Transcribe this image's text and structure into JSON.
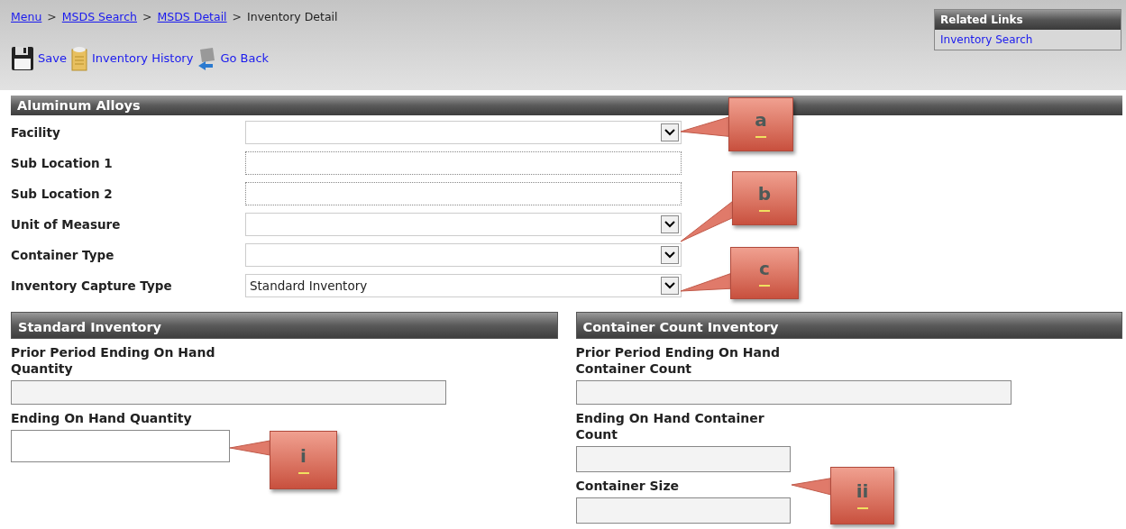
{
  "breadcrumb": [
    {
      "label": "Menu",
      "link": true
    },
    {
      "label": "MSDS Search",
      "link": true
    },
    {
      "label": "MSDS Detail",
      "link": true
    },
    {
      "label": "Inventory Detail",
      "link": false
    }
  ],
  "breadcrumb_separator": ">",
  "toolbar": [
    {
      "label": "Save",
      "kind": "save"
    },
    {
      "label": "Inventory History",
      "kind": "history"
    },
    {
      "label": "Go Back",
      "kind": "back"
    }
  ],
  "related_links": {
    "title": "Related Links",
    "items": [
      "Inventory Search"
    ]
  },
  "section": {
    "title": "Aluminum Alloys",
    "fields": [
      {
        "label": "Facility",
        "kind": "select"
      },
      {
        "label": "Sub Location 1",
        "kind": "text"
      },
      {
        "label": "Sub Location 2",
        "kind": "text"
      },
      {
        "label": "Unit of Measure",
        "kind": "select"
      },
      {
        "label": "Container Type",
        "kind": "select"
      },
      {
        "label": "Inventory Capture Type",
        "kind": "select",
        "value": "Standard Inventory"
      }
    ]
  },
  "panels": [
    {
      "title": "Standard Inventory",
      "fields": [
        {
          "label": "Prior Period Ending On Hand Quantity",
          "disabled": true,
          "kind": "wide"
        },
        {
          "label": "Ending On Hand Quantity",
          "disabled": false,
          "kind": "short"
        }
      ]
    },
    {
      "title": "Container Count Inventory",
      "fields": [
        {
          "label": "Prior Period Ending On Hand Container Count",
          "disabled": true,
          "kind": "wide"
        },
        {
          "label": "Ending On Hand Container Count",
          "disabled": true,
          "kind": "short"
        },
        {
          "label": "Container Size",
          "disabled": true,
          "kind": "short"
        }
      ]
    }
  ],
  "callouts": [
    {
      "label": "a"
    },
    {
      "label": "b"
    },
    {
      "label": "c"
    },
    {
      "label": "i"
    },
    {
      "label": "ii"
    }
  ]
}
